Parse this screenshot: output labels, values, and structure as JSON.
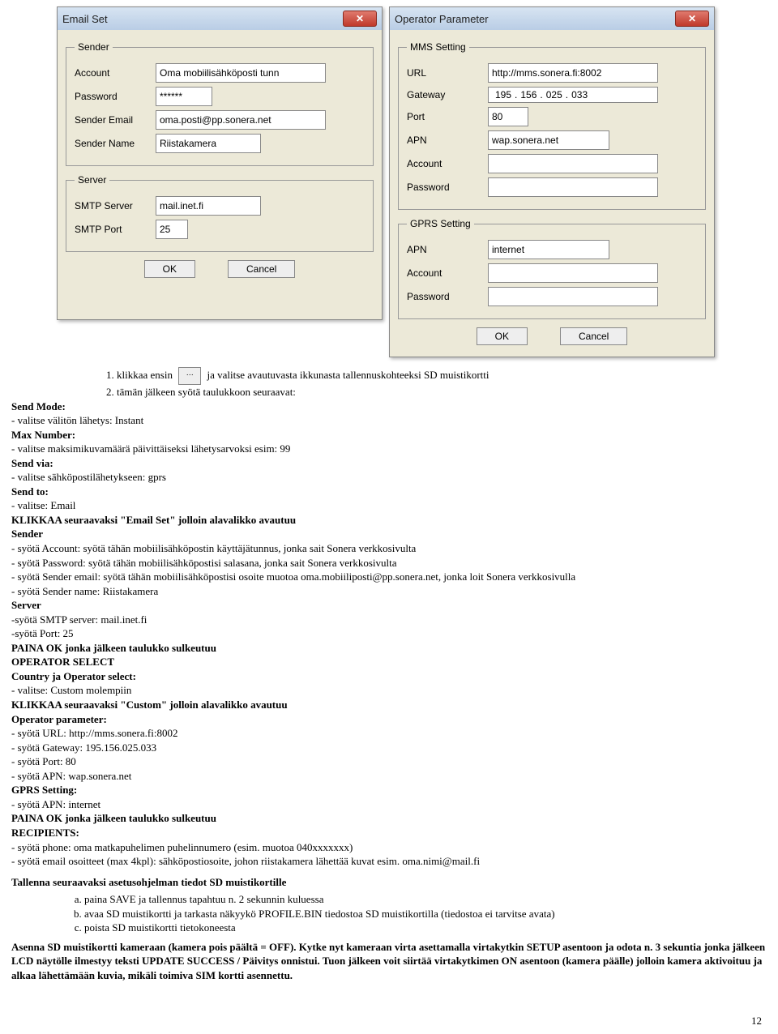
{
  "emailSet": {
    "title": "Email Set",
    "sender": {
      "legend": "Sender",
      "accountLabel": "Account",
      "accountValue": "Oma mobiilisähköposti tunn",
      "passwordLabel": "Password",
      "passwordValue": "******",
      "emailLabel": "Sender Email",
      "emailValue": "oma.posti@pp.sonera.net",
      "nameLabel": "Sender Name",
      "nameValue": "Riistakamera"
    },
    "server": {
      "legend": "Server",
      "smtpLabel": "SMTP Server",
      "smtpValue": "mail.inet.fi",
      "portLabel": "SMTP Port",
      "portValue": "25"
    },
    "ok": "OK",
    "cancel": "Cancel"
  },
  "opParam": {
    "title": "Operator Parameter",
    "mms": {
      "legend": "MMS Setting",
      "urlLabel": "URL",
      "urlValue": "http://mms.sonera.fi:8002",
      "gatewayLabel": "Gateway",
      "gw1": "195",
      "gw2": "156",
      "gw3": "025",
      "gw4": "033",
      "portLabel": "Port",
      "portValue": "80",
      "apnLabel": "APN",
      "apnValue": "wap.sonera.net",
      "accountLabel": "Account",
      "accountValue": "",
      "passwordLabel": "Password",
      "passwordValue": ""
    },
    "gprs": {
      "legend": "GPRS Setting",
      "apnLabel": "APN",
      "apnValue": "internet",
      "accountLabel": "Account",
      "accountValue": "",
      "passwordLabel": "Password",
      "passwordValue": ""
    },
    "ok": "OK",
    "cancel": "Cancel"
  },
  "text": {
    "li1a": "klikkaa ensin",
    "li1b": "ja valitse avautuvasta ikkunasta tallennuskohteeksi SD muistikortti",
    "li2": "tämän jälkeen syötä taulukkoon seuraavat:",
    "sendMode": "Send Mode:",
    "sendModeV": "- valitse välitön lähetys: Instant",
    "maxNum": "Max Number:",
    "maxNumV": "- valitse maksimikuvamäärä päivittäiseksi lähetysarvoksi esim: 99",
    "sendVia": "Send via:",
    "sendViaV": "- valitse sähköpostilähetykseen: gprs",
    "sendTo": "Send to:",
    "sendToV": "- valitse: Email",
    "klikEmail": "KLIKKAA seuraavaksi \"Email Set\" jolloin alavalikko avautuu",
    "sender": "Sender",
    "senderAcc": "- syötä Account: syötä tähän mobiilisähköpostin käyttäjätunnus, jonka sait Sonera verkkosivulta",
    "senderPw": " - syötä Password: syötä tähän mobiilisähköpostisi salasana, jonka sait Sonera verkkosivulta",
    "senderEm": "- syötä Sender email: syötä tähän mobiilisähköpostisi osoite muotoa oma.mobiiliposti@pp.sonera.net, jonka loit Sonera verkkosivulla",
    "senderNm": "- syötä Sender name: Riistakamera",
    "server": "Server",
    "smtp": "-syötä SMTP server: mail.inet.fi",
    "port25": "-syötä Port: 25",
    "painaok1": "PAINA OK jonka jälkeen taulukko sulkeutuu",
    "opsel": "OPERATOR SELECT",
    "cos": "Country ja Operator select:",
    "cosV": "- valitse: Custom molempiin",
    "klikCustom": "KLIKKAA seuraavaksi \"Custom\" jolloin alavalikko avautuu",
    "opparam": "Operator parameter:",
    "url": " - syötä URL: http://mms.sonera.fi:8002",
    "gw": "- syötä Gateway: 195.156.025.033",
    "port80": "- syötä Port: 80",
    "apn1": "- syötä APN: wap.sonera.net",
    "gprsSet": "GPRS Setting:",
    "apn2": "- syötä APN: internet",
    "painaok2": "PAINA OK jonka jälkeen taulukko sulkeutuu",
    "recip": "RECIPIENTS:",
    "phone": "- syötä phone: oma matkapuhelimen puhelinnumero (esim. muotoa 040xxxxxxx)",
    "emails": " - syötä email osoitteet (max 4kpl): sähköpostiosoite, johon riistakamera lähettää kuvat esim. oma.nimi@mail.fi",
    "tall": "Tallenna seuraavaksi asetusohjelman tiedot SD muistikortille",
    "la": "paina SAVE ja tallennus tapahtuu n. 2 sekunnin kuluessa",
    "lb": "avaa SD muistikortti ja tarkasta näkyykö PROFILE.BIN tiedostoa SD muistikortilla (tiedostoa ei tarvitse avata)",
    "lc": "poista SD muistikortti tietokoneesta",
    "asenna": "Asenna SD muistikortti kameraan (kamera pois päältä = OFF). Kytke nyt kameraan virta asettamalla virtakytkin SETUP asentoon ja odota n. 3 sekuntia jonka jälkeen LCD näytölle ilmestyy teksti UPDATE SUCCESS / Päivitys onnistui. Tuon jälkeen voit siirtää virtakytkimen ON asentoon (kamera päälle) jolloin kamera aktivoituu ja alkaa lähettämään kuvia, mikäli toimiva SIM kortti asennettu.",
    "page": "12"
  }
}
